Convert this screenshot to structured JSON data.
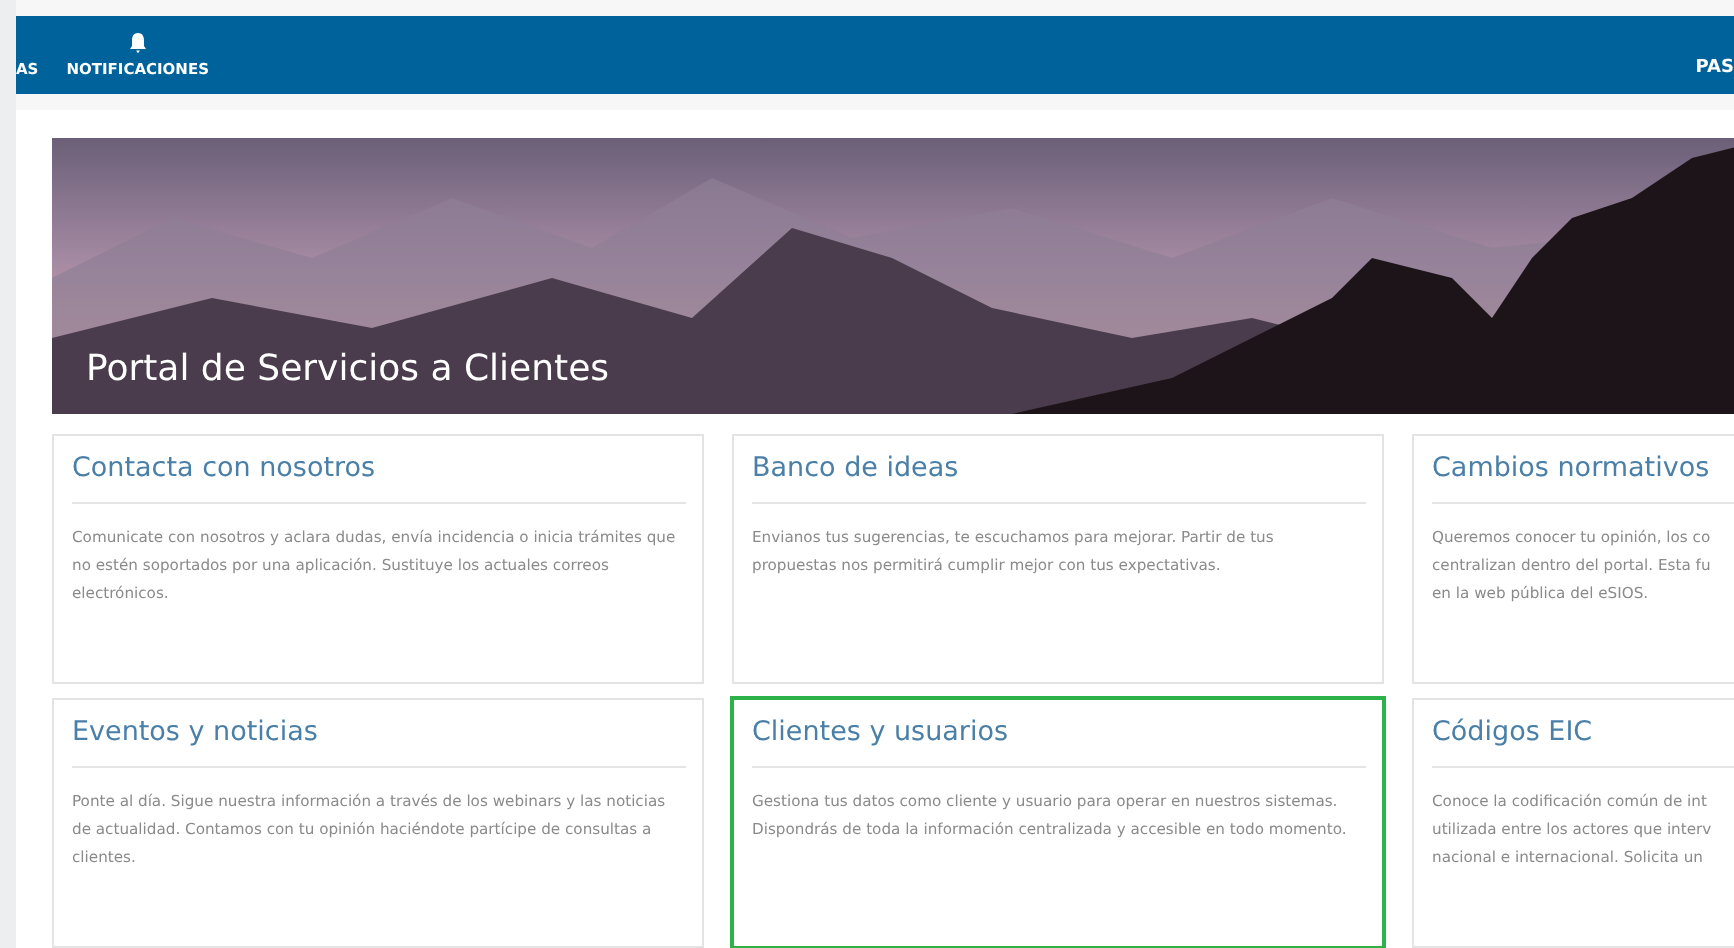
{
  "top_bar": {
    "nav_items": [
      {
        "label": "AS",
        "kind": "text"
      },
      {
        "label": "NOTIFICACIONES",
        "kind": "bell"
      }
    ],
    "right_label": "PAS"
  },
  "banner": {
    "title": "Portal de Servicios a Clientes"
  },
  "cards": [
    {
      "title": "Contacta con nosotros",
      "description": "Comunicate con nosotros y aclara dudas, envía incidencia o inicia trámites que no estén soportados por una aplicación. Sustituye los actuales correos electrónicos.",
      "selected": false
    },
    {
      "title": "Banco de ideas",
      "description": "Envianos tus sugerencias, te escuchamos para mejorar. Partir de tus propuestas nos permitirá cumplir mejor con tus expectativas.",
      "selected": false
    },
    {
      "title": "Cambios normativos",
      "lines": [
        "Queremos conocer tu opinión, los co",
        "centralizan dentro del portal. Esta fu",
        "en la web pública del eSIOS."
      ],
      "selected": false
    },
    {
      "title": "Eventos y noticias",
      "description": "Ponte al día. Sigue nuestra información a través de los webinars y las noticias de actualidad. Contamos con tu opinión haciéndote partícipe de consultas a clientes.",
      "selected": false
    },
    {
      "title": "Clientes y usuarios",
      "description": "Gestiona tus datos como cliente y usuario para operar en nuestros sistemas. Dispondrás de toda la información centralizada y accesible en todo momento.",
      "selected": true
    },
    {
      "title": "Códigos EIC",
      "lines": [
        "Conoce la codificación común de int",
        "utilizada entre los actores que interv",
        "nacional e internacional. Solicita un"
      ],
      "selected": false
    }
  ]
}
